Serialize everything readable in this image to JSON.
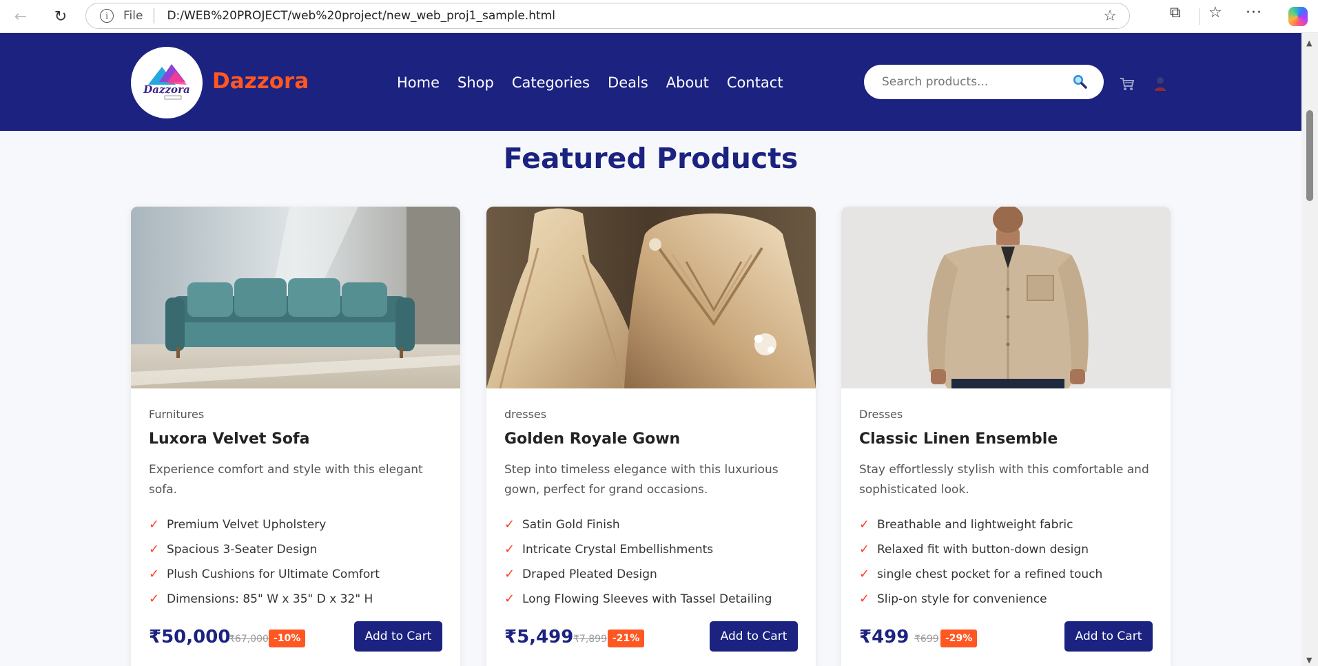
{
  "browser": {
    "file_label": "File",
    "url": "D:/WEB%20PROJECT/web%20project/new_web_proj1_sample.html"
  },
  "header": {
    "brand": "Dazzora",
    "logo_text": "Dazzora",
    "nav": [
      "Home",
      "Shop",
      "Categories",
      "Deals",
      "About",
      "Contact"
    ],
    "search_placeholder": "Search products...",
    "icons": [
      "search-icon",
      "cart-icon",
      "user-icon"
    ],
    "colors": {
      "header_bg": "#1b2280",
      "brand": "#ff5722",
      "accent": "#ff5722"
    }
  },
  "section": {
    "title": "Featured Products"
  },
  "products": [
    {
      "category": "Furnitures",
      "name": "Luxora Velvet Sofa",
      "description": "Experience comfort and style with this elegant sofa.",
      "features": [
        "Premium Velvet Upholstery",
        "Spacious 3-Seater Design",
        "Plush Cushions for Ultimate Comfort",
        "Dimensions: 85\" W x 35\" D x 32\" H"
      ],
      "price": "₹50,000",
      "old_price": "₹67,000",
      "discount": "-10%",
      "button": "Add to Cart"
    },
    {
      "category": "dresses",
      "name": "Golden Royale Gown",
      "description": "Step into timeless elegance with this luxurious gown, perfect for grand occasions.",
      "features": [
        "Satin Gold Finish",
        "Intricate Crystal Embellishments",
        "Draped Pleated Design",
        "Long Flowing Sleeves with Tassel Detailing"
      ],
      "price": "₹5,499",
      "old_price": "₹7,899",
      "discount": "-21%",
      "button": "Add to Cart"
    },
    {
      "category": "Dresses",
      "name": "Classic Linen Ensemble",
      "description": "Stay effortlessly stylish with this comfortable and sophisticated look.",
      "features": [
        "Breathable and lightweight fabric",
        "Relaxed fit with button-down design",
        "single chest pocket for a refined touch",
        "Slip-on style for convenience"
      ],
      "price": "₹499",
      "old_price": "₹699",
      "discount": "-29%",
      "button": "Add to Cart"
    }
  ]
}
